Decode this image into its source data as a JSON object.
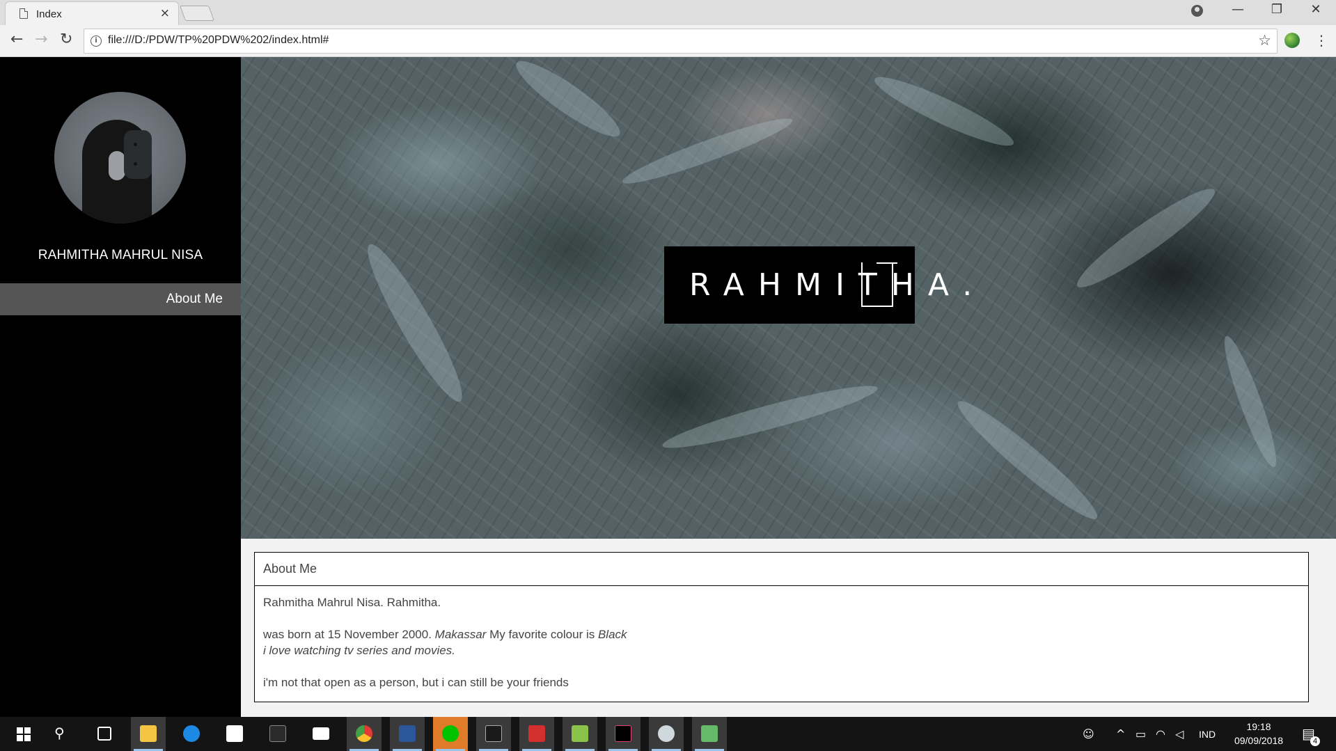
{
  "browser": {
    "tab_title": "Index",
    "tab_close": "×",
    "url": "file:///D:/PDW/TP%20PDW%202/index.html#",
    "back": "←",
    "forward": "→",
    "reload": "↻",
    "bookmark_star": "☆",
    "menu": "⋮",
    "win_minimize": "—",
    "win_restore": "❐",
    "win_close": "✕"
  },
  "sidebar": {
    "name": "RAHMITHA MAHRUL NISA",
    "nav": [
      {
        "label": "About Me"
      }
    ]
  },
  "hero": {
    "logo_text": "RAHMITHA."
  },
  "about": {
    "title": "About Me",
    "line1": "Rahmitha Mahrul Nisa. Rahmitha.",
    "born_prefix": "was born at 15 November 2000. ",
    "born_city": "Makassar",
    "colour_prefix": " My favorite colour is ",
    "colour_value": "Black",
    "hobby": "i love watching tv series and movies.",
    "line4": "i'm not that open as a person, but i can still be your friends"
  },
  "taskbar": {
    "apps": [
      {
        "name": "search",
        "color": "#ffffff"
      },
      {
        "name": "task-view",
        "color": "#ffffff"
      },
      {
        "name": "file-explorer",
        "color": "#f4c542"
      },
      {
        "name": "edge",
        "color": "#1e88e5"
      },
      {
        "name": "store",
        "color": "#ffffff"
      },
      {
        "name": "netbeans",
        "color": "#2b2b2b"
      },
      {
        "name": "mail",
        "color": "#ffffff"
      },
      {
        "name": "chrome",
        "color": "#e53935"
      },
      {
        "name": "word",
        "color": "#2b579a"
      },
      {
        "name": "line",
        "color": "#00c300"
      },
      {
        "name": "cmd",
        "color": "#1a1a1a"
      },
      {
        "name": "acrobat",
        "color": "#d32f2f"
      },
      {
        "name": "notepad-plus",
        "color": "#8bc34a"
      },
      {
        "name": "intellij",
        "color": "#000000"
      },
      {
        "name": "photoscape",
        "color": "#cfd8dc"
      },
      {
        "name": "app-green",
        "color": "#66bb6a"
      }
    ],
    "language": "IND",
    "time": "19:18",
    "date": "09/09/2018",
    "notifications": "4"
  }
}
